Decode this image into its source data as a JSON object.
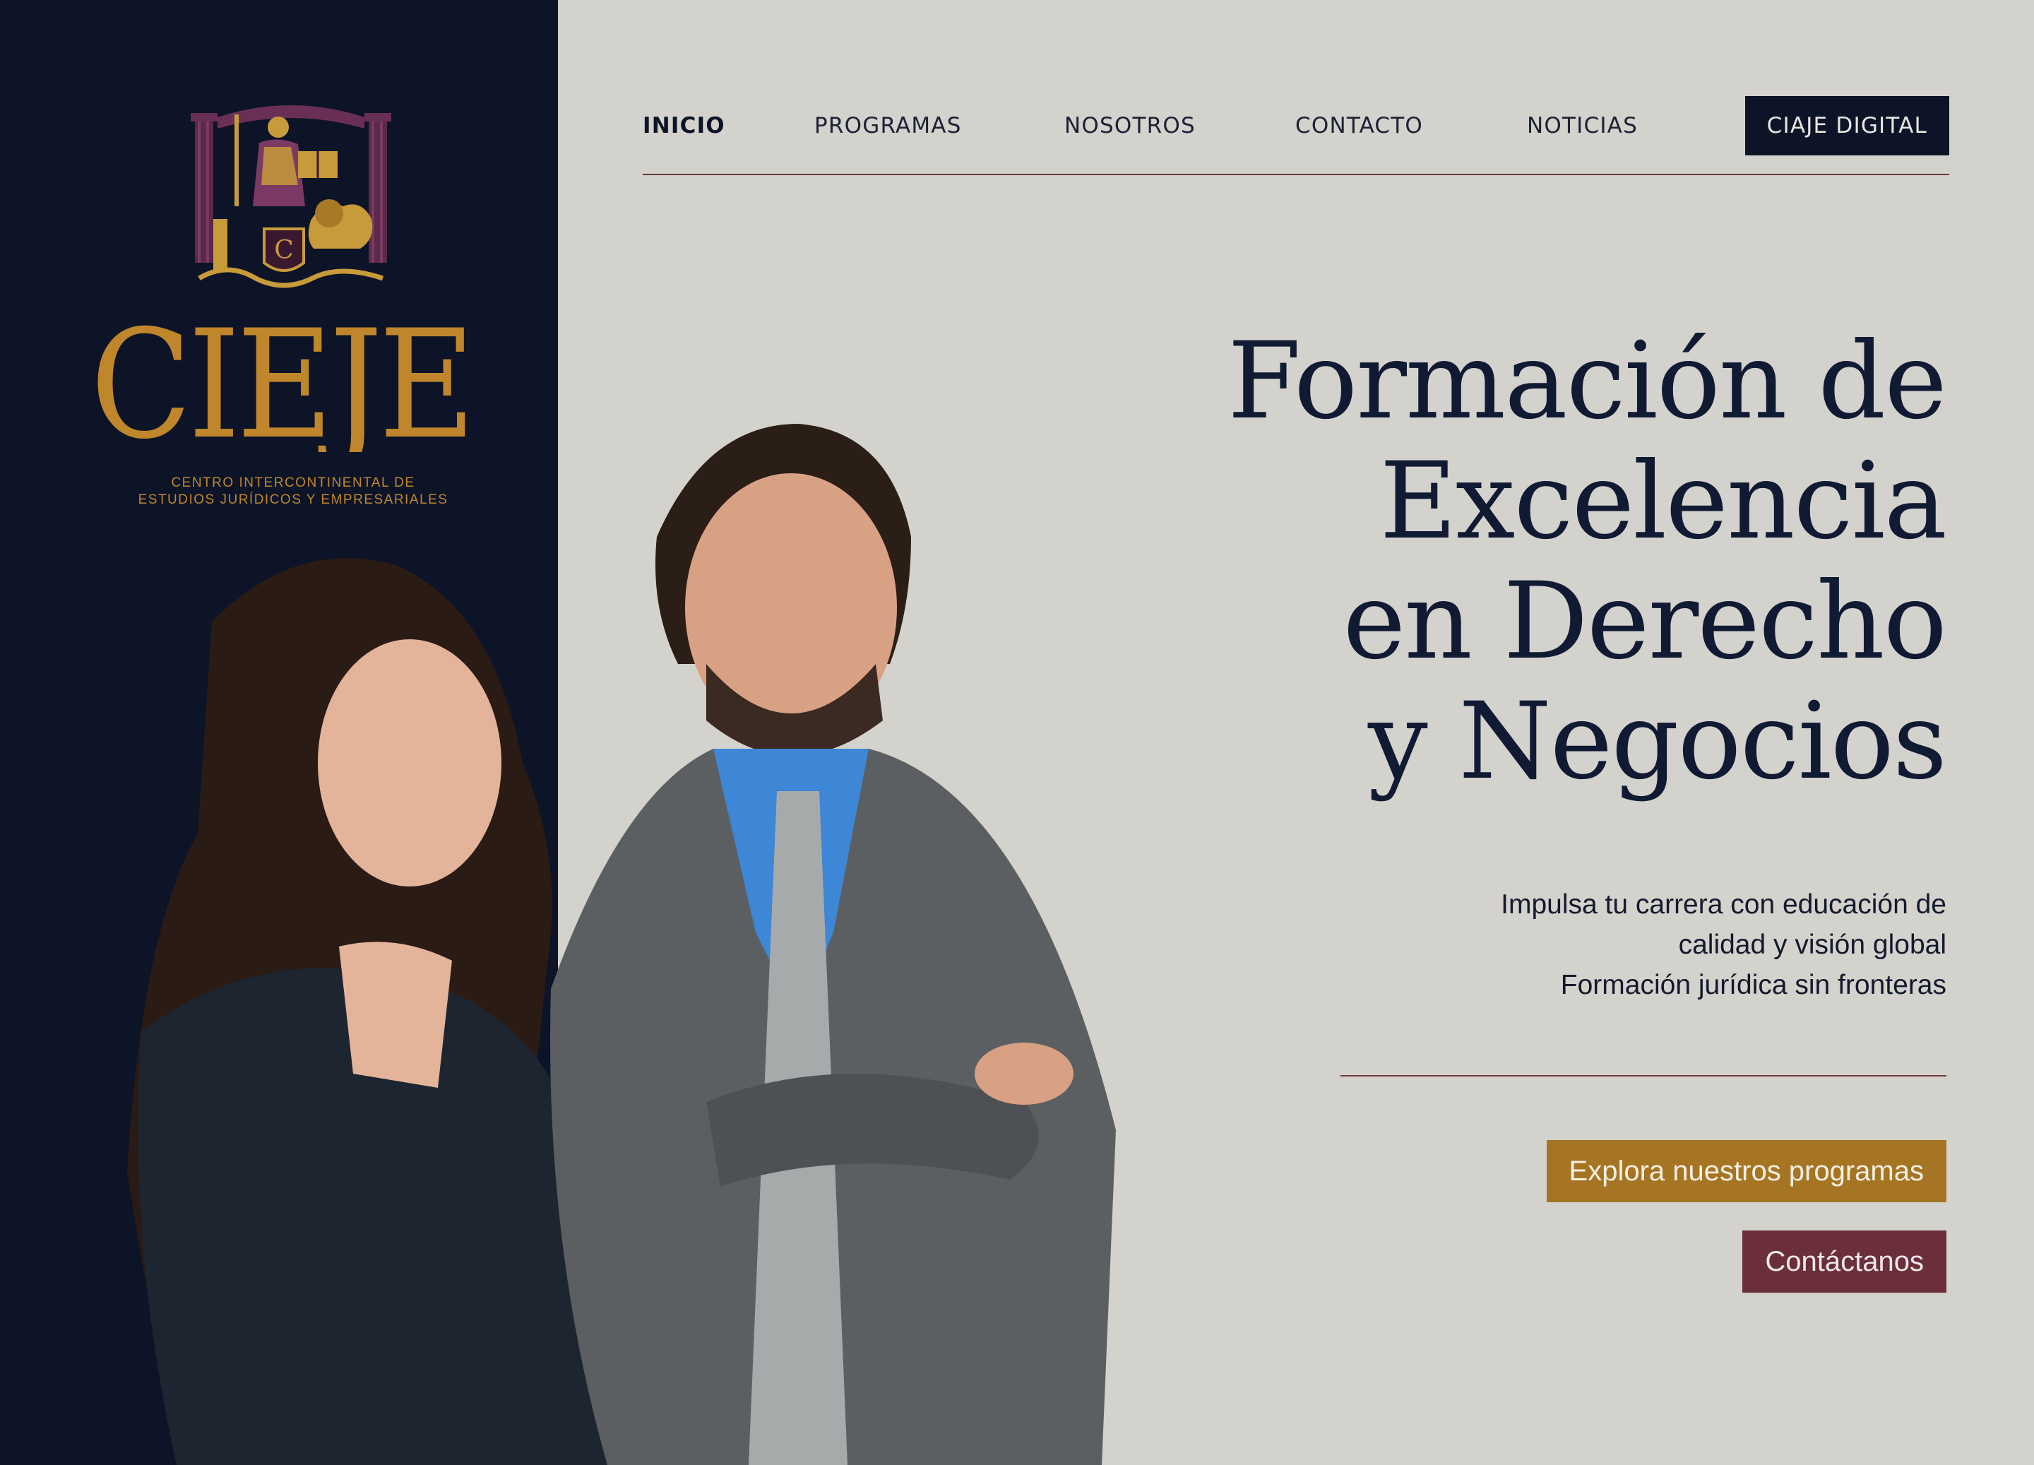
{
  "brand": {
    "name": "CIEJE",
    "subtitle_line1": "CENTRO INTERCONTINENTAL DE",
    "subtitle_line2": "ESTUDIOS JURÍDICOS Y EMPRESARIALES",
    "colors": {
      "navy": "#0d1428",
      "gold": "#c0862b",
      "burgundy": "#6a2f3a",
      "background": "#d4d2cd"
    }
  },
  "nav": {
    "items": [
      {
        "label": "INICIO",
        "active": true
      },
      {
        "label": "PROGRAMAS",
        "active": false
      },
      {
        "label": "NOSOTROS",
        "active": false
      },
      {
        "label": "CONTACTO",
        "active": false
      },
      {
        "label": "NOTICIAS",
        "active": false
      }
    ],
    "cta_label": "CIAJE DIGITAL"
  },
  "hero": {
    "headline": [
      "Formación de",
      "Excelencia",
      "en Derecho",
      "y Negocios"
    ],
    "subtext": [
      "Impulsa tu carrera con educación de",
      "calidad y visión global",
      "Formación jurídica sin fronteras"
    ],
    "primary_button": "Explora nuestros programas",
    "secondary_button": "Contáctanos"
  },
  "imagery": {
    "crest": "classical-figure-and-lion-crest",
    "photo": "two-professionals-portrait"
  }
}
